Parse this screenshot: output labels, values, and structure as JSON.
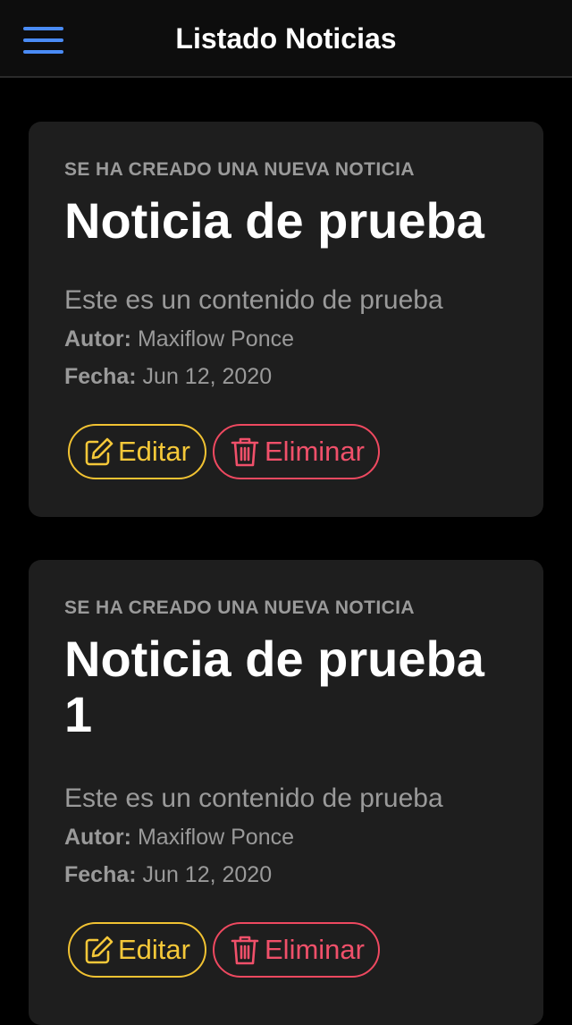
{
  "toolbar": {
    "title": "Listado Noticias",
    "menu_icon": "hamburger-menu-icon",
    "accent_color": "#4a8bf5"
  },
  "news": [
    {
      "subtitle": "Se ha creado una nueva noticia",
      "title": "Noticia de prueba",
      "content": "Este es un contenido de prueba",
      "author_label": "Autor:",
      "author": "Maxiflow Ponce",
      "date_label": "Fecha:",
      "date": "Jun 12, 2020",
      "edit_label": "Editar",
      "delete_label": "Eliminar"
    },
    {
      "subtitle": "Se ha creado una nueva noticia",
      "title": "Noticia de prueba 1",
      "content": "Este es un contenido de prueba",
      "author_label": "Autor:",
      "author": "Maxiflow Ponce",
      "date_label": "Fecha:",
      "date": "Jun 12, 2020",
      "edit_label": "Editar",
      "delete_label": "Eliminar"
    }
  ],
  "colors": {
    "edit": "#f5c839",
    "delete": "#f0506a",
    "card_background": "#1e1e1e"
  }
}
